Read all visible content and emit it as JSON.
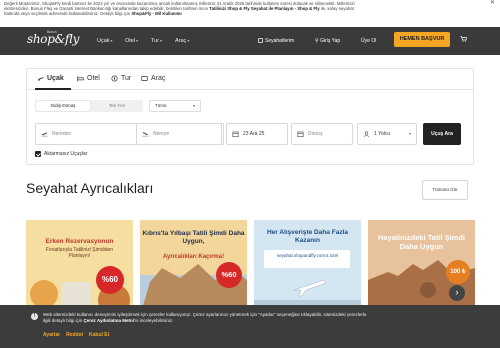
{
  "notice": {
    "line1": "Değerli Müşterimiz, Shop&Fly kredi kartınız ile 2023 yılı ve öncesinde kazanılmış ancak kullanılmamış milleriniz 31 Aralık 2025 tarihinde kullanım süresi dolacak ve silinecektir. Millerinizi",
    "line2a": "ekstrenizden, Bonus Flaş ve Garanti İnternet Bankacılığı kanallarından takip edebilir, belirtilen tarihten önce ",
    "line2b": "Tatilinizi Shop & Fly Seyahat ile Planlayın - Shop & Fly",
    "line2c": " ile, kolay seyahat",
    "line3a": "hattında veya seçilmek adresinde kullanabilirsiniz. Detaylı bilgi için ",
    "line3b": "Shop&Fly - Mil Kullanımı",
    "close": "✕"
  },
  "header": {
    "logo": "shop&fly",
    "logo_top": "Bonus",
    "nav": [
      {
        "label": "Uçak"
      },
      {
        "label": "Otel"
      },
      {
        "label": "Tur"
      },
      {
        "label": "Araç"
      }
    ],
    "links": {
      "trips": "Seyahatlerim",
      "login": "Giriş Yap",
      "member": "Üye Ol"
    },
    "cta": "HEMEN BAŞVUR"
  },
  "search": {
    "tabs": [
      {
        "label": "Uçak"
      },
      {
        "label": "Otel"
      },
      {
        "label": "Tur"
      },
      {
        "label": "Araç"
      }
    ],
    "trip_type": {
      "selected": "Gidiş-Dönüş",
      "other": "Tek Yön"
    },
    "class_select": "Tümü",
    "from_placeholder": "Nereden",
    "to_placeholder": "Nereye",
    "depart_date": "23 Ara 25",
    "return_placeholder": "Dönüş",
    "passengers": "1 Yolcu",
    "search_button": "Uçuş Ara",
    "nonstop_label": "Aktarmasız Uçuşlar"
  },
  "opportunities": {
    "title": "Seyahat Ayrıcalıkları",
    "see_all": "Tümünü Gör",
    "cards": [
      {
        "title": "Erken Rezervasyonun",
        "sub": "Fırsatlarıyla Tatilinizi Şimdiden Planlayın!",
        "badge": "%60"
      },
      {
        "title": "Kıbrıs'ta Yılbaşı Tatili Şimdi Daha Uygun,",
        "sub": "Ayrıcalıkları Kaçırma!",
        "badge": "%60"
      },
      {
        "title": "Her Alışverişte Daha Fazla Kazanın",
        "sub": "seyahat.shopandfly.com'a özel",
        "badge": ""
      },
      {
        "title": "Hayalinizdeki Tatil Şimdi Daha Uygun",
        "sub": "",
        "badge": "100 ₺"
      }
    ]
  },
  "cookie": {
    "text_a": "Web sitemizdeki kullanıcı deneyimini iyileştirmek için çerezler kullanıyoruz. Çerez ayarlarınızı yönetmek için \"Ayarlar\" seçeneğine tıklayabilir, sitemizdeki çerezlerle",
    "text_b": "ilgili detaylı bilgi için ",
    "text_link": "Çerez Aydınlatma Metni",
    "text_c": "'ni inceleyebilirsiniz.",
    "actions": [
      "Ayarlar",
      "Reddet",
      "Kabul Et"
    ]
  }
}
